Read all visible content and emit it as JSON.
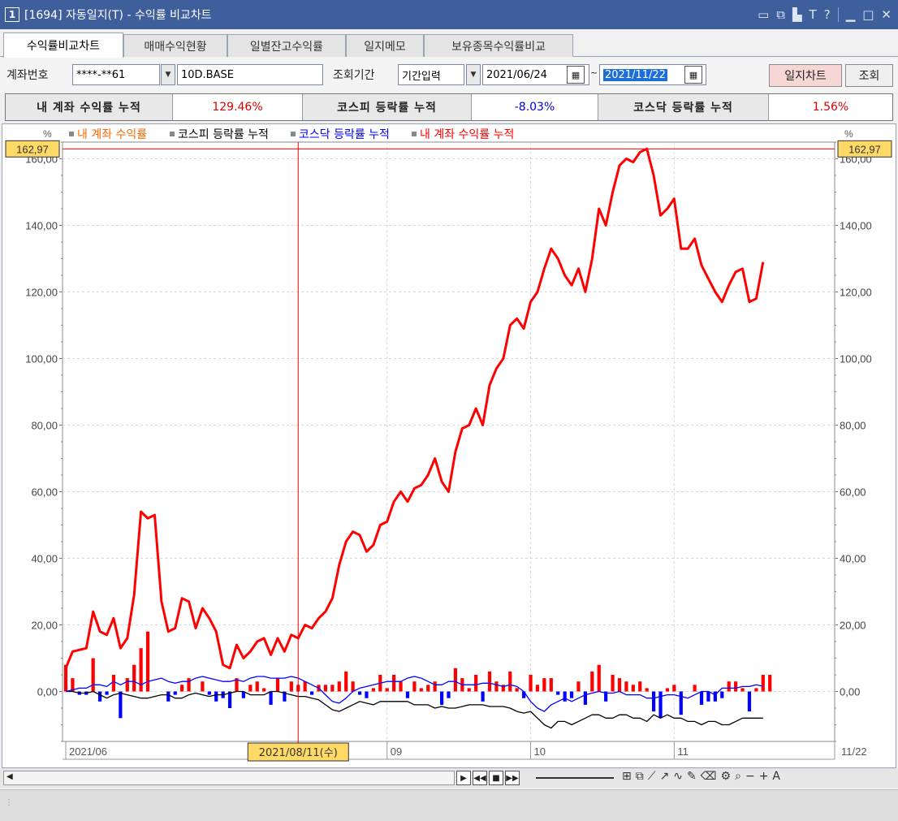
{
  "window": {
    "number": "1",
    "title": "[1694] 자동일지(T) - 수익률 비교차트",
    "icons": [
      "restore-icon",
      "cascade-icon",
      "pin-icon",
      "font-icon",
      "help-icon",
      "minimize-icon",
      "maximize-icon",
      "close-icon"
    ]
  },
  "tabs": [
    "수익률비교차트",
    "매매수익현황",
    "일별잔고수익률",
    "일지메모",
    "보유종목수익률비교"
  ],
  "toolbar": {
    "account_label": "계좌번호",
    "account_value": "****-**61",
    "account_name": "10D.BASE",
    "period_label": "조회기간",
    "period_mode": "기간입력",
    "date_from": "2021/06/24",
    "tilde": "~",
    "date_to": "2021/11/22",
    "btn_daily_chart": "일지차트",
    "btn_search": "조회"
  },
  "summary": {
    "my_label": "내 계좌 수익률 누적",
    "my_value": "129.46%",
    "kospi_label": "코스피 등락률 누적",
    "kospi_value": "-8.03%",
    "kosdaq_label": "코스닥 등락률 누적",
    "kosdaq_value": "1.56%"
  },
  "colors": {
    "my": "#ff0000",
    "kospi": "#000000",
    "kosdaq": "#0000ff",
    "bar_pos": "#ff0000",
    "bar_neg": "#0000ff",
    "legend_daily": "#ff6600"
  },
  "chart_data": {
    "type": "line",
    "unit_label": "%",
    "legend": [
      {
        "name": "내 계좌 수익률",
        "color": "#ff6600"
      },
      {
        "name": "코스피 등락률 누적",
        "color": "#000000"
      },
      {
        "name": "코스닥 등락률 누적",
        "color": "#0000ff"
      },
      {
        "name": "내 계좌 수익률 누적",
        "color": "#ff0000"
      }
    ],
    "ylim": [
      -15,
      165
    ],
    "yticks": [
      0,
      20,
      40,
      60,
      80,
      100,
      120,
      140,
      160
    ],
    "ytick_labels": [
      "0,00",
      "20,00",
      "40,00",
      "60,00",
      "80,00",
      "100,00",
      "120,00",
      "140,00",
      "160,00"
    ],
    "max_marker_label": "162,97",
    "max_value": 162.97,
    "xaxis_labels": [
      {
        "label": "2021/06",
        "index": 0
      },
      {
        "label": "09",
        "index": 47
      },
      {
        "label": "10",
        "index": 68
      },
      {
        "label": "11",
        "index": 89
      },
      {
        "label": "11/22",
        "index": 112
      }
    ],
    "crosshair_index": 34,
    "crosshair_label": "2021/08/11(수)",
    "n_points": 113,
    "series": [
      {
        "name": "내 계좌 수익률 누적",
        "values": [
          7,
          12,
          12.5,
          13,
          24,
          18,
          17,
          22,
          13,
          16,
          29,
          54,
          52,
          53,
          27,
          18,
          19,
          28,
          27,
          19,
          25,
          22,
          18,
          8,
          7,
          14,
          10,
          12,
          15,
          16,
          11,
          16,
          12,
          17,
          16,
          20,
          19,
          22,
          24,
          28,
          38,
          45,
          48,
          47,
          42,
          44,
          50,
          51,
          57,
          60,
          57,
          61,
          62,
          65,
          70,
          63,
          60,
          72,
          79,
          80,
          85,
          80,
          92,
          97,
          100,
          110,
          112,
          109,
          117,
          120,
          127,
          133,
          130,
          125,
          122,
          127,
          120,
          130,
          145,
          140,
          150,
          158,
          160,
          159,
          162,
          163,
          155,
          143,
          145,
          148,
          133,
          133,
          136,
          128,
          124,
          120,
          117,
          122,
          126,
          127,
          117,
          118,
          129,
          129.46,
          129.46,
          129.46,
          129.46,
          129.46,
          129.46,
          129.46,
          129.46,
          129.46,
          129.46
        ]
      },
      {
        "name": "코스피 등락률 누적",
        "values": [
          0,
          0,
          -0.5,
          -0.5,
          0,
          -1,
          -2,
          -1,
          -0.5,
          -1,
          -1.5,
          -2,
          -2,
          -1.5,
          -1,
          -1,
          -2,
          -2,
          -1,
          -0.5,
          -1,
          -1.5,
          -1,
          -1,
          -0.5,
          0,
          0,
          -1,
          -1,
          -1,
          0,
          0,
          -0.5,
          -1,
          -1.5,
          -1.5,
          -2,
          -2.5,
          -4,
          -5.5,
          -6,
          -5,
          -4,
          -3,
          -3.5,
          -4,
          -3,
          -3,
          -3,
          -3,
          -3,
          -4,
          -4,
          -4,
          -5,
          -4.5,
          -5,
          -5,
          -4.5,
          -4,
          -4,
          -4,
          -4.5,
          -4.5,
          -4.5,
          -5,
          -6,
          -6.5,
          -6,
          -8,
          -10,
          -11,
          -9,
          -9,
          -10,
          -9,
          -8,
          -7,
          -7,
          -8,
          -8,
          -7,
          -7,
          -8,
          -8,
          -9,
          -7,
          -8,
          -7,
          -8,
          -8,
          -9,
          -9,
          -10,
          -9,
          -9,
          -10,
          -10,
          -9,
          -8,
          -8,
          -8,
          -8,
          -7,
          -8.03,
          -8.03,
          -8.03,
          -8.03,
          -8.03,
          -8.03,
          -8.03,
          -8.03,
          -8.03,
          -8.03,
          -8.03
        ]
      },
      {
        "name": "코스닥 등락률 누적",
        "values": [
          0,
          0.5,
          1,
          1,
          2,
          2,
          1.5,
          3,
          2,
          3,
          3,
          2,
          3,
          3.5,
          4,
          3,
          2.5,
          3,
          3,
          4,
          4.5,
          4,
          3.5,
          3,
          3,
          3.5,
          3,
          4,
          4.5,
          4.5,
          4,
          4,
          4,
          4.5,
          4,
          3,
          2,
          1,
          -1,
          -3,
          -3.5,
          -2,
          0,
          1,
          1.5,
          2,
          2.5,
          3,
          3,
          3,
          4,
          4.5,
          4,
          3,
          2,
          2,
          3,
          3,
          2,
          2,
          2,
          2.5,
          2.5,
          2,
          1.5,
          2,
          1.5,
          0,
          -3,
          -5,
          -6,
          -4,
          -3,
          -2,
          -3,
          -2,
          -1,
          -0.5,
          0,
          -0.5,
          -0.5,
          0,
          -1,
          -1,
          -1,
          -2,
          -2,
          -1.5,
          -1,
          -1,
          -1.5,
          -2,
          -1,
          0,
          0,
          -1,
          1,
          1,
          1,
          1.5,
          1.5,
          2,
          1.56,
          1.56,
          1.56,
          1.56,
          1.56,
          1.56,
          1.56,
          1.56,
          1.56,
          1.56,
          1.56,
          1.56
        ]
      },
      {
        "name": "내 계좌 수익률",
        "values": [
          8,
          4,
          -1,
          -1,
          10,
          -3,
          -1,
          5,
          -8,
          4,
          8,
          13,
          18,
          0,
          0,
          -3,
          -1,
          2,
          4,
          0,
          3,
          -1,
          -3,
          -2,
          -5,
          4,
          -2,
          2,
          3,
          1,
          -4,
          4,
          -3,
          3,
          2,
          3,
          -1,
          2,
          2,
          2,
          3,
          6,
          3,
          -1,
          -2,
          1,
          5,
          1,
          5,
          3,
          -2,
          3,
          1,
          2,
          3,
          -4,
          -2,
          7,
          4,
          1,
          5,
          -3,
          6,
          3,
          2,
          6,
          1,
          -2,
          5,
          2,
          4,
          4,
          -1,
          -3,
          -2,
          3,
          -4,
          6,
          8,
          -3,
          5,
          4,
          3,
          2,
          3,
          1,
          -6,
          -8,
          1,
          2,
          -7,
          0,
          2,
          -4,
          -3,
          -3,
          -2,
          3,
          3,
          1,
          -6,
          1,
          5,
          5,
          0,
          0,
          0,
          0,
          0,
          0,
          0,
          0,
          0,
          0
        ]
      }
    ]
  },
  "bottom": {
    "controls": [
      "play-icon",
      "rewind-icon",
      "stop-icon",
      "fast-forward-icon"
    ]
  }
}
